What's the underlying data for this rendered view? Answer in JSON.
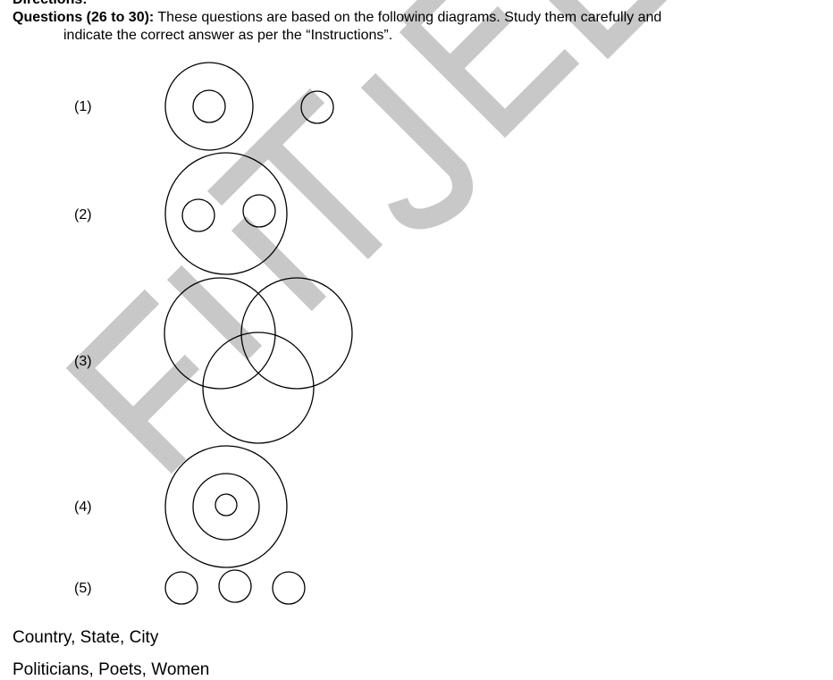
{
  "directions_heading": "Directions:",
  "instructions": {
    "lead": "Questions (26 to 30):",
    "text": "These questions are based on the following diagrams. Study them carefully and",
    "continuation": "indicate the correct answer as per the “Instructions”."
  },
  "watermark": {
    "text": "FIITJEE",
    "color": "#c8c8c8"
  },
  "diagrams": [
    {
      "label": "(1)"
    },
    {
      "label": "(2)"
    },
    {
      "label": "(3)"
    },
    {
      "label": "(4)"
    },
    {
      "label": "(5)"
    }
  ],
  "answers": [
    {
      "text": "Country, State, City"
    },
    {
      "text": "Politicians, Poets, Women"
    }
  ]
}
